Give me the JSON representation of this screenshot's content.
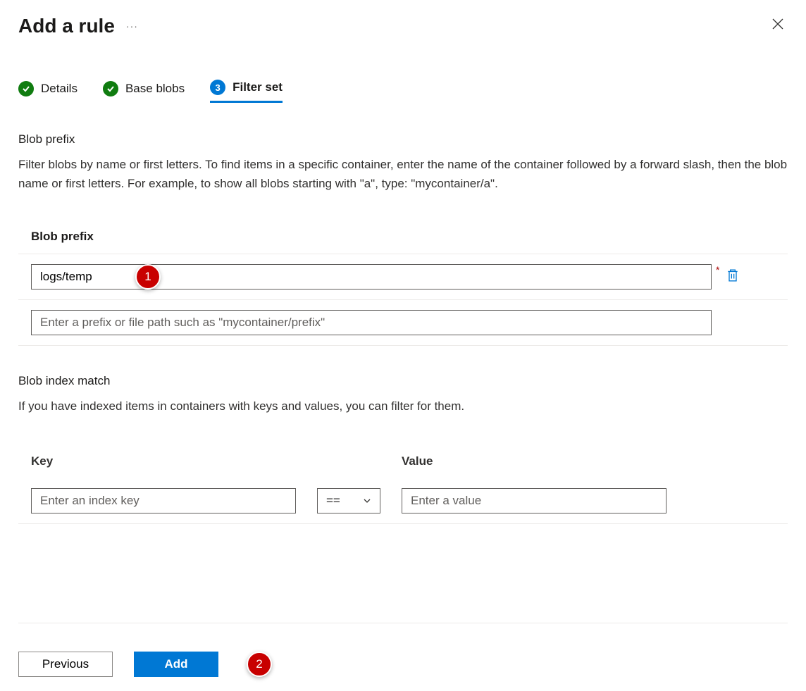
{
  "header": {
    "title": "Add a rule"
  },
  "steps": [
    {
      "label": "Details",
      "state": "complete"
    },
    {
      "label": "Base blobs",
      "state": "complete"
    },
    {
      "label": "Filter set",
      "state": "current",
      "num": "3"
    }
  ],
  "blobPrefix": {
    "sectionLabel": "Blob prefix",
    "description": "Filter blobs by name or first letters. To find items in a specific container, enter the name of the container followed by a forward slash, then the blob name or first letters. For example, to show all blobs starting with \"a\", type: \"mycontainer/a\".",
    "columnHeader": "Blob prefix",
    "rows": [
      {
        "value": "logs/temp",
        "required": true,
        "deletable": true
      },
      {
        "value": "",
        "placeholder": "Enter a prefix or file path such as \"mycontainer/prefix\""
      }
    ]
  },
  "blobIndex": {
    "sectionLabel": "Blob index match",
    "description": "If you have indexed items in containers with keys and values, you can filter for them.",
    "keyHeader": "Key",
    "valueHeader": "Value",
    "row": {
      "keyPlaceholder": "Enter an index key",
      "operator": "==",
      "valuePlaceholder": "Enter a value"
    }
  },
  "footer": {
    "previous": "Previous",
    "add": "Add"
  },
  "callouts": {
    "c1": "1",
    "c2": "2"
  }
}
